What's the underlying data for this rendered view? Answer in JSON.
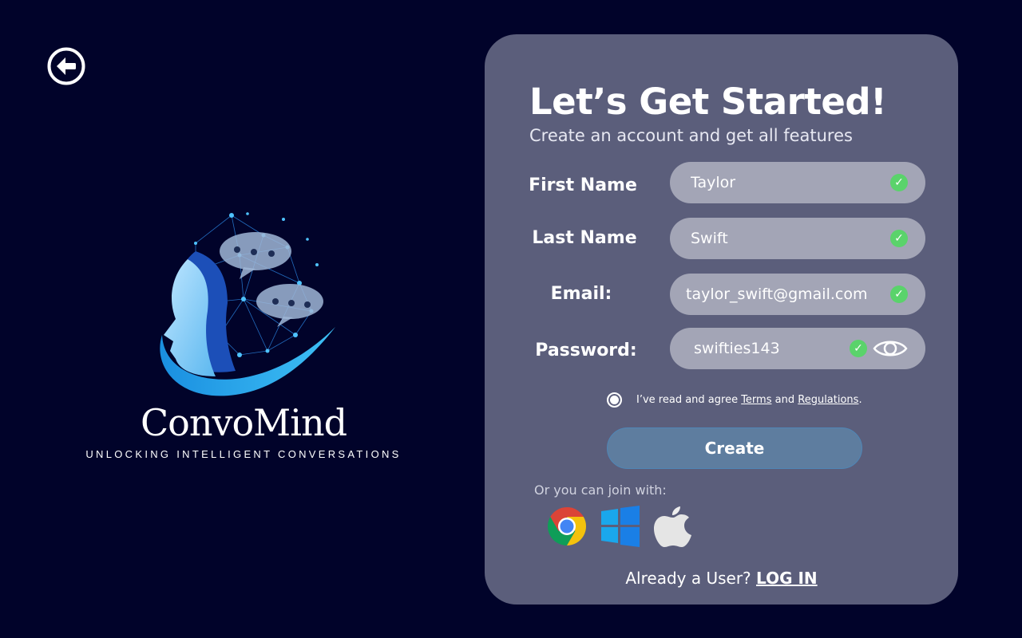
{
  "nav": {
    "back_icon": "arrow-left-circle-icon"
  },
  "brand": {
    "name": "ConvoMind",
    "tagline": "UNLOCKING INTELLIGENT CONVERSATIONS",
    "logo_icon": "ai-head-chat-network-logo"
  },
  "form": {
    "title": "Let’s Get Started!",
    "subtitle": "Create an account and get all features",
    "fields": [
      {
        "label": "First Name",
        "value": "Taylor",
        "valid": true
      },
      {
        "label": "Last Name",
        "value": "Swift",
        "valid": true
      },
      {
        "label": "Email:",
        "value": "taylor_swift@gmail.com",
        "valid": true
      },
      {
        "label": "Password:",
        "value": "swifties143",
        "valid": true
      }
    ],
    "password_toggle_icon": "eye-icon",
    "agree": {
      "prefix": "I’ve read and agree",
      "terms": "Terms",
      "and": "and",
      "regulations": "Regulations",
      "suffix": ".",
      "checked": false
    },
    "create_label": "Create",
    "join_text": "Or you can join with:",
    "social": [
      {
        "icon": "chrome-icon"
      },
      {
        "icon": "windows-icon"
      },
      {
        "icon": "apple-icon"
      }
    ],
    "already_text": "Already a User?",
    "login_label": "LOG IN"
  },
  "colors": {
    "background": "#01032a",
    "card": "#5b5e7b",
    "field": "#a3a5b6",
    "valid": "#5ad36b",
    "button": "#5e7d9f"
  }
}
